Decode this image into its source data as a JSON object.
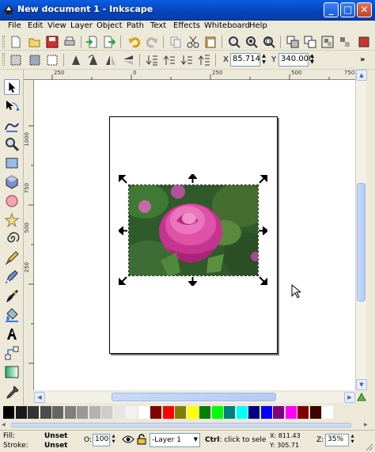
{
  "window": {
    "title": "New document 1 - Inkscape",
    "buttons": {
      "minimize": "_",
      "maximize": "□",
      "close": "✕"
    }
  },
  "menu": [
    "File",
    "Edit",
    "View",
    "Layer",
    "Object",
    "Path",
    "Text",
    "Effects",
    "Whiteboard",
    "Help"
  ],
  "toolbar": {
    "x_label": "X",
    "x_value": "85.714",
    "y_label": "Y",
    "y_value": "340.000"
  },
  "rulers": {
    "horizontal": [
      "250",
      "0",
      "250",
      "500",
      "750"
    ],
    "vertical": [
      "1000",
      "750",
      "500",
      "250"
    ]
  },
  "palette": {
    "colors": [
      "#000000",
      "#1a1a1a",
      "#333333",
      "#4d4d4d",
      "#666666",
      "#808080",
      "#999999",
      "#b3b3b3",
      "#cccccc",
      "#e6e6e6",
      "#f2f2f2",
      "#ffffff",
      "#800000",
      "#ff0000",
      "#808000",
      "#ffff00",
      "#008000",
      "#00ff00",
      "#008080",
      "#00ffff",
      "#000080",
      "#0000ff",
      "#800080",
      "#ff00ff",
      "#800000",
      "#400000",
      "#ffffff"
    ]
  },
  "status": {
    "fill_label": "Fill:",
    "fill_value": "Unset",
    "stroke_label": "Stroke:",
    "stroke_value": "Unset",
    "opacity_label": "O:",
    "opacity_value": "100",
    "layer_value": "-Layer 1",
    "message_bold": "Ctrl",
    "message_rest": ": click to select i",
    "x_readout": "X:  811.43",
    "y_readout": "Y:  305.71",
    "zoom_label": "Z:",
    "zoom_value": "35%"
  }
}
